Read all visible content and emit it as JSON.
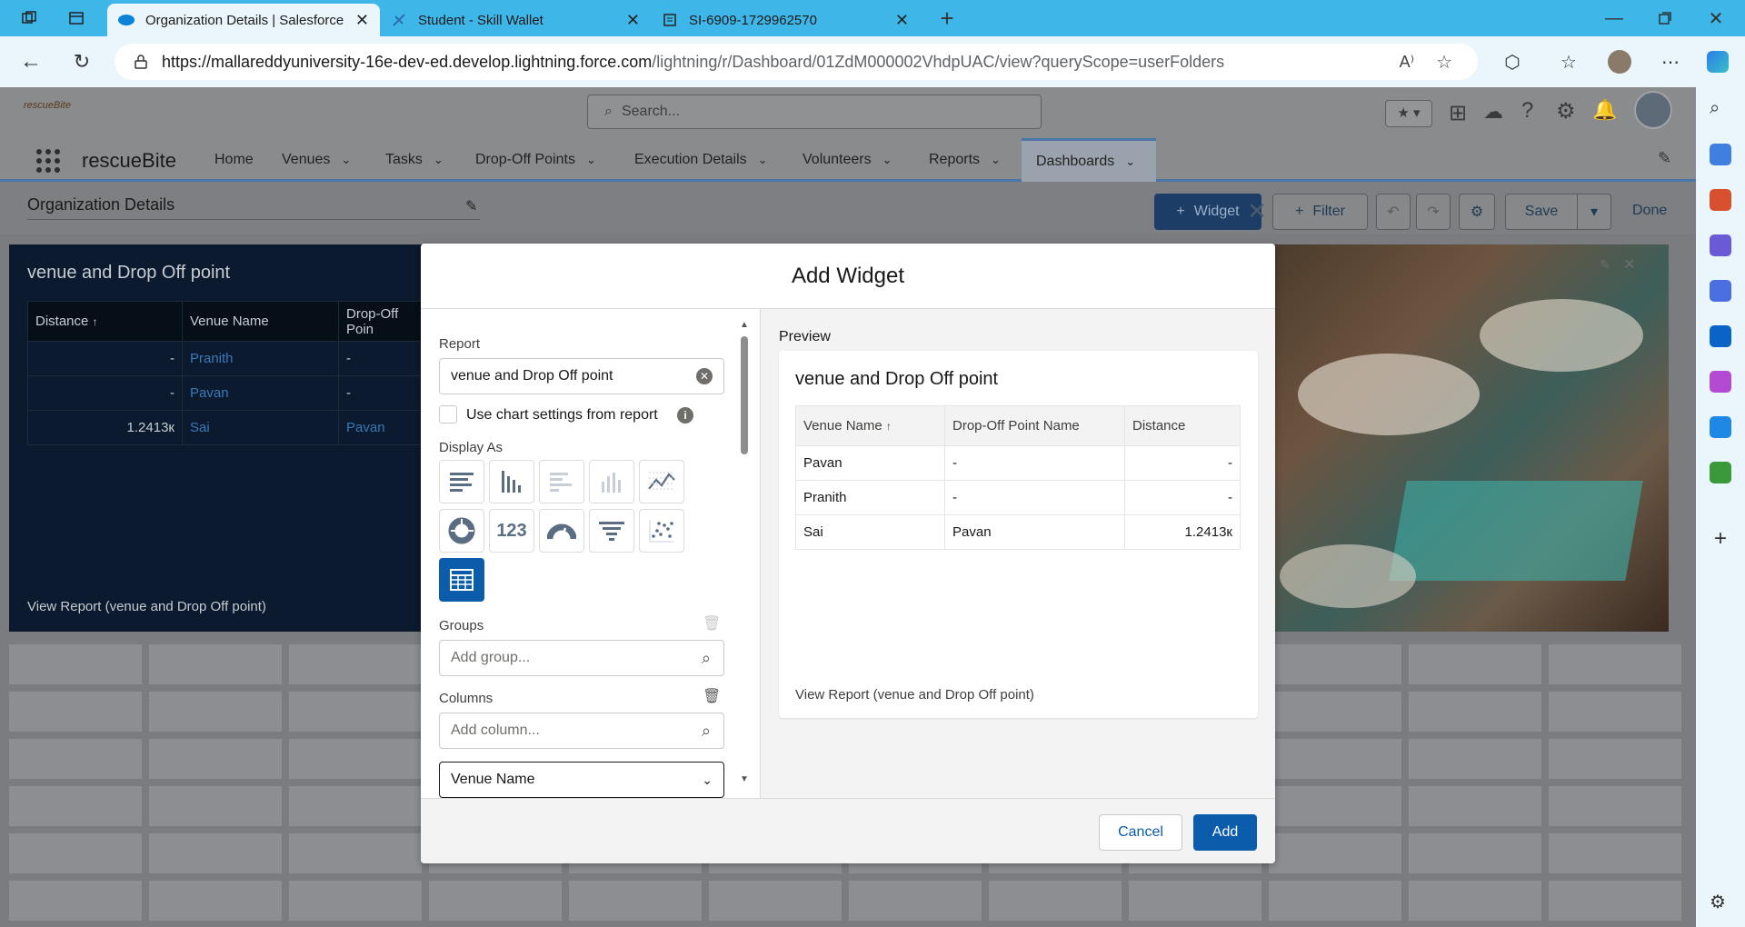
{
  "browser": {
    "tabs": [
      {
        "title": "Organization Details | Salesforce",
        "active": true
      },
      {
        "title": "Student - Skill Wallet",
        "active": false
      },
      {
        "title": "SI-6909-1729962570",
        "active": false
      }
    ],
    "url_host": "https://mallareddyuniversity-16e-dev-ed.develop.lightning.force.com",
    "url_path": "/lightning/r/Dashboard/01ZdM000002VhdpUAC/view?queryScope=userFolders"
  },
  "sf": {
    "logo_text": "rescueBite",
    "search_placeholder": "Search...",
    "app_name": "rescueBite",
    "nav": [
      {
        "label": "Home"
      },
      {
        "label": "Venues"
      },
      {
        "label": "Tasks"
      },
      {
        "label": "Drop-Off Points"
      },
      {
        "label": "Execution Details"
      },
      {
        "label": "Volunteers"
      },
      {
        "label": "Reports"
      },
      {
        "label": "Dashboards"
      }
    ],
    "dashboard_title": "Organization Details",
    "toolbar": {
      "widget": "Widget",
      "filter": "Filter",
      "save": "Save",
      "done": "Done"
    }
  },
  "report_widget": {
    "title": "venue and Drop Off point",
    "columns": [
      "Distance",
      "Venue Name",
      "Drop-Off Poin"
    ],
    "rows": [
      [
        "-",
        "Pranith",
        "-"
      ],
      [
        "-",
        "Pavan",
        "-"
      ],
      [
        "1.2413к",
        "Sai",
        "Pavan"
      ]
    ],
    "footer": "View Report (venue and Drop Off point)"
  },
  "modal": {
    "title": "Add Widget",
    "report_label": "Report",
    "report_value": "venue and Drop Off point",
    "chart_settings_label": "Use chart settings from report",
    "display_as_label": "Display As",
    "groups_label": "Groups",
    "groups_placeholder": "Add group...",
    "columns_label": "Columns",
    "columns_placeholder": "Add column...",
    "column_item": "Venue Name",
    "preview_label": "Preview",
    "preview": {
      "title": "venue and Drop Off point",
      "columns": [
        "Venue Name",
        "Drop-Off Point Name",
        "Distance"
      ],
      "rows": [
        [
          "Pavan",
          "-",
          "-"
        ],
        [
          "Pranith",
          "-",
          "-"
        ],
        [
          "Sai",
          "Pavan",
          "1.2413к"
        ]
      ],
      "footer": "View Report (venue and Drop Off point)"
    },
    "cancel": "Cancel",
    "add": "Add",
    "metric_icon_text": "123"
  },
  "colors": {
    "brand": "#0b5cab",
    "browser_tabbar": "#3fb6e8"
  }
}
